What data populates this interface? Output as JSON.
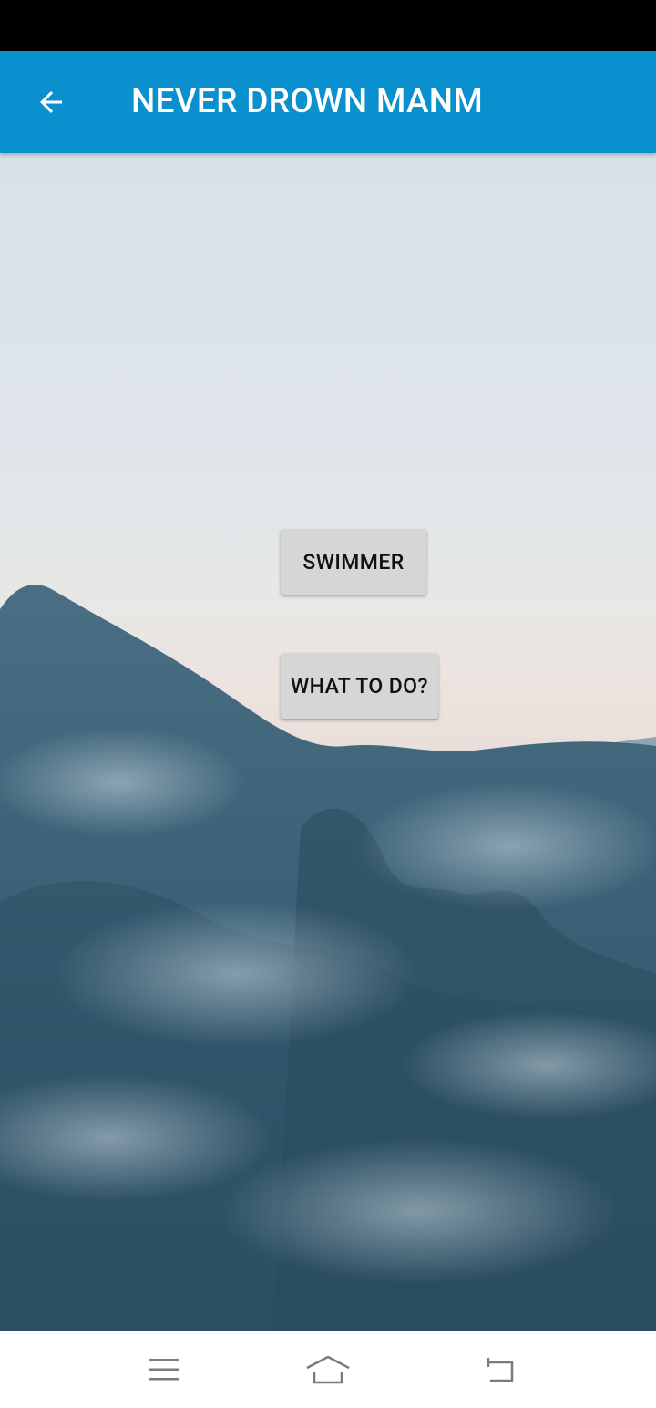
{
  "app_bar": {
    "title": "NEVER DROWN MANM",
    "color": "#0a8fcf",
    "back_icon": "arrow-left-icon"
  },
  "background": {
    "description_icon": "ocean-wave-background"
  },
  "buttons": {
    "swimmer_label": "SWIMMER",
    "what_to_do_label": "WHAT TO DO?"
  },
  "nav_bar": {
    "menu_icon": "menu-icon",
    "home_icon": "home-icon",
    "back_icon": "back-icon"
  }
}
